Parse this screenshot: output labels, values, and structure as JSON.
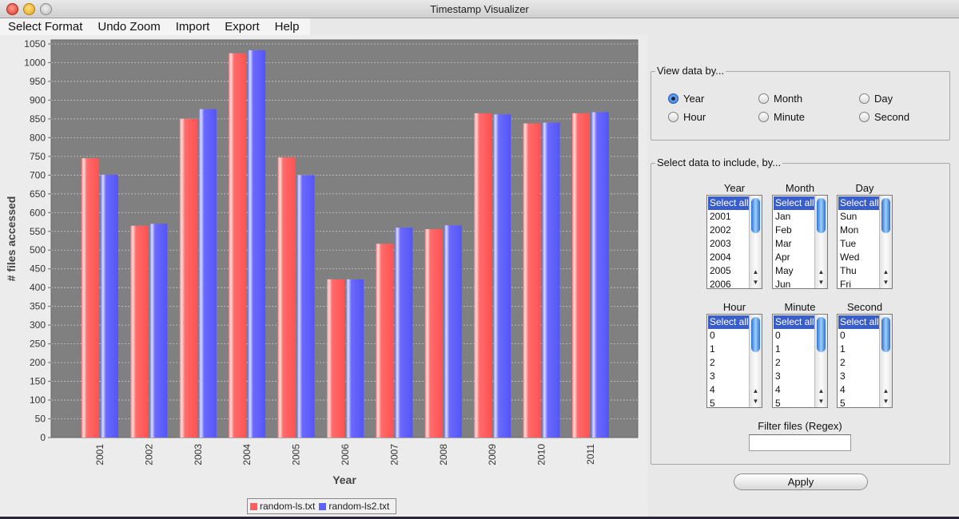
{
  "window": {
    "title": "Timestamp Visualizer"
  },
  "menu": [
    "Select Format",
    "Undo Zoom",
    "Import",
    "Export",
    "Help"
  ],
  "colors": {
    "series1": "#ff5f5f",
    "series2": "#6060ff",
    "plot_bg": "#808080"
  },
  "view_by": {
    "title": "View data by...",
    "options": [
      "Year",
      "Month",
      "Day",
      "Hour",
      "Minute",
      "Second"
    ],
    "selected": "Year"
  },
  "include": {
    "title": "Select data to include, by...",
    "lists": [
      {
        "title": "Year",
        "items": [
          "Select all",
          "2001",
          "2002",
          "2003",
          "2004",
          "2005",
          "2006"
        ]
      },
      {
        "title": "Month",
        "items": [
          "Select all",
          "Jan",
          "Feb",
          "Mar",
          "Apr",
          "May",
          "Jun"
        ]
      },
      {
        "title": "Day",
        "items": [
          "Select all",
          "Sun",
          "Mon",
          "Tue",
          "Wed",
          "Thu",
          "Fri"
        ]
      },
      {
        "title": "Hour",
        "items": [
          "Select all",
          "0",
          "1",
          "2",
          "3",
          "4",
          "5"
        ]
      },
      {
        "title": "Minute",
        "items": [
          "Select all",
          "0",
          "1",
          "2",
          "3",
          "4",
          "5"
        ]
      },
      {
        "title": "Second",
        "items": [
          "Select all",
          "0",
          "1",
          "2",
          "3",
          "4",
          "5"
        ]
      }
    ]
  },
  "filter": {
    "label": "Filter files (Regex)",
    "value": ""
  },
  "apply_label": "Apply",
  "chart_data": {
    "type": "bar",
    "xlabel": "Year",
    "ylabel": "# files accessed",
    "ylim": [
      0,
      1050
    ],
    "ytick_step": 50,
    "grid": true,
    "legend_position": "bottom",
    "categories": [
      "2001",
      "2002",
      "2003",
      "2004",
      "2005",
      "2006",
      "2007",
      "2008",
      "2009",
      "2010",
      "2011"
    ],
    "series": [
      {
        "name": "random-ls.txt",
        "values": [
          745,
          565,
          850,
          1025,
          747,
          422,
          517,
          556,
          865,
          838,
          865
        ]
      },
      {
        "name": "random-ls2.txt",
        "values": [
          701,
          570,
          876,
          1033,
          700,
          422,
          560,
          566,
          862,
          840,
          868
        ]
      }
    ]
  }
}
